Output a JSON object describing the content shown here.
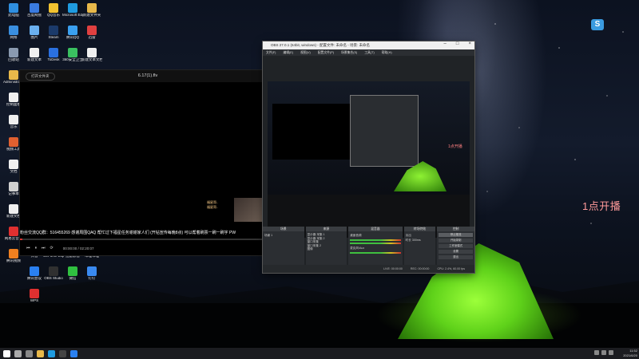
{
  "desktop": {
    "icons": [
      {
        "label": "此电脑",
        "color": "#2f8fe0"
      },
      {
        "label": "百度网盘",
        "color": "#3a7be0"
      },
      {
        "label": "QQ音乐",
        "color": "#f2c230"
      },
      {
        "label": "Microsoft Edge",
        "color": "#1f9be0"
      },
      {
        "label": "新建文件夹",
        "color": "#e8b84a"
      },
      {
        "label": "网络",
        "color": "#3a8fe0"
      },
      {
        "label": "图片",
        "color": "#6ab0f0"
      },
      {
        "label": "Steam",
        "color": "#1b3a6a"
      },
      {
        "label": "腾讯QQ",
        "color": "#3aa0f0"
      },
      {
        "label": "迅雷",
        "color": "#e04040"
      },
      {
        "label": "回收站",
        "color": "#8a9ab0"
      },
      {
        "label": "新建文本",
        "color": "#f0f0f0"
      },
      {
        "label": "ToDesk",
        "color": "#2a70e0"
      },
      {
        "label": "360安全卫士",
        "color": "#3ac060"
      },
      {
        "label": "新建文本文档",
        "color": "#f0f0f0"
      },
      {
        "label": "Administrator",
        "color": "#e8b84a"
      },
      {
        "label": "控制面板",
        "color": "#f0f0f0"
      },
      {
        "label": "音乐",
        "color": "#f0f0f0"
      },
      {
        "label": "视频工具",
        "color": "#e06030"
      },
      {
        "label": "文档",
        "color": "#f0f0f0"
      },
      {
        "label": "记事本",
        "color": "#d0d0d0"
      },
      {
        "label": "新建文档",
        "color": "#f0f0f0"
      },
      {
        "label": "网易云音乐",
        "color": "#e03030"
      },
      {
        "label": "腾讯视频",
        "color": "#f08020"
      },
      {
        "label": "爱奇艺",
        "color": "#4ac040"
      },
      {
        "label": "剪映",
        "color": "#222222"
      },
      {
        "label": "YY",
        "color": "#f2d030"
      },
      {
        "label": "QQ浏览器",
        "color": "#3aa0f0"
      },
      {
        "label": "抖音",
        "color": "#111111"
      },
      {
        "label": "GeForce Experience",
        "color": "#76b900"
      },
      {
        "label": "迅雷影音",
        "color": "#2080e0"
      },
      {
        "label": "哔哩哔哩",
        "color": "#f080a0"
      },
      {
        "label": "腾讯会议",
        "color": "#2a80f0"
      },
      {
        "label": "OBS Studio",
        "color": "#303030"
      },
      {
        "label": "微信",
        "color": "#30c040"
      },
      {
        "label": "钉钉",
        "color": "#3a8af0"
      },
      {
        "label": "WPS",
        "color": "#e03030"
      }
    ]
  },
  "player": {
    "open_button": "打开文件夹",
    "title": "6.17(1).flv",
    "marquee": "粉丝交流QQ群：516455269  感谢周围QAQ 帮忙过下福星任务谢谢家人们 (开钻宣传每晚8点) 可以帮着刷票一刷一刷字  PW",
    "webcam_labels": [
      "福星哥..",
      "福星哥.."
    ],
    "progress": 0.01,
    "time": "00:00:00 / 02:20:07",
    "controls": [
      "上一个",
      "暂停",
      "下一个",
      "循环"
    ]
  },
  "obs": {
    "title": "OBS 27.0.1 (64bit, windows) - 配置文件: 未命名 - 场景: 未命名",
    "menu": [
      "文件(F)",
      "编辑(E)",
      "视图(V)",
      "配置文件(P)",
      "场景集合(S)",
      "工具(T)",
      "帮助(H)"
    ],
    "preview_overlay_text": "1点开播",
    "panels": {
      "scenes": {
        "header": "场景",
        "items": [
          "场景 1"
        ]
      },
      "sources": {
        "header": "来源",
        "items": [
          "显示器 采集 1",
          "显示器 采集 2",
          "窗口采集",
          "窗口采集 2",
          "图像"
        ]
      },
      "mixer": {
        "header": "混音器",
        "items": [
          "桌面音频",
          "麦克风/Aux"
        ]
      },
      "transitions": {
        "header": "转场特效",
        "items": [
          "淡出",
          "时长 300ms"
        ]
      },
      "controls": {
        "header": "控制",
        "buttons": [
          "停止推流",
          "开始录制",
          "工作室模式",
          "设置",
          "退出"
        ]
      }
    },
    "status": [
      "LIVE: 00:00:00",
      "REC: 00:00:00",
      "CPU: 2.4%, 60.00 fps"
    ]
  },
  "overlay_text": "1点开播",
  "taskbar": {
    "apps": [
      "开始",
      "搜索",
      "任务视图",
      "文件资源管理器",
      "Edge",
      "OBS Studio",
      "播放器"
    ],
    "time": "11:52",
    "date": "2021/6/20"
  }
}
